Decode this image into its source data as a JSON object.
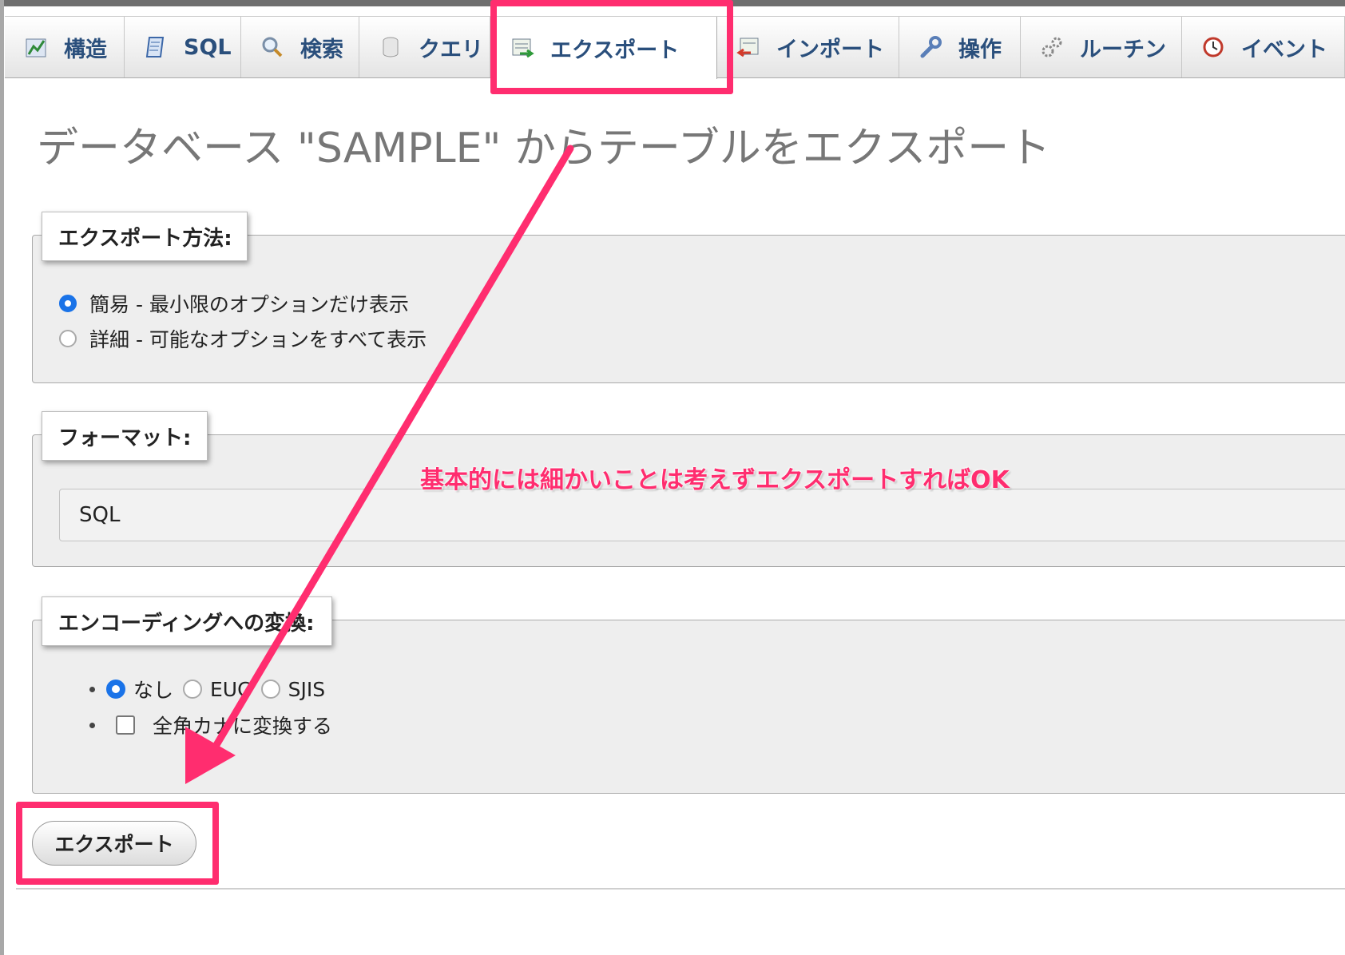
{
  "tabs": [
    {
      "label": "構造",
      "icon": "structure-icon"
    },
    {
      "label": "SQL",
      "icon": "sql-icon"
    },
    {
      "label": "検索",
      "icon": "search-icon"
    },
    {
      "label": "クエリ",
      "icon": "query-icon"
    },
    {
      "label": "エクスポート",
      "icon": "export-icon",
      "active": true
    },
    {
      "label": "インポート",
      "icon": "import-icon"
    },
    {
      "label": "操作",
      "icon": "wrench-icon"
    },
    {
      "label": "ルーチン",
      "icon": "gears-icon"
    },
    {
      "label": "イベント",
      "icon": "clock-icon"
    }
  ],
  "page": {
    "title": "データベース \"SAMPLE\" からテーブルをエクスポート"
  },
  "export_method": {
    "legend": "エクスポート方法:",
    "options": [
      {
        "label": "簡易 - 最小限のオプションだけ表示",
        "checked": true
      },
      {
        "label": "詳細 - 可能なオプションをすべて表示",
        "checked": false
      }
    ]
  },
  "format": {
    "legend": "フォーマット:",
    "selected": "SQL"
  },
  "encoding": {
    "legend": "エンコーディングへの変換:",
    "options": [
      {
        "label": "なし",
        "checked": true
      },
      {
        "label": "EUC",
        "checked": false
      },
      {
        "label": "SJIS",
        "checked": false
      }
    ],
    "checkbox_label": "全角カナに変換する",
    "checkbox_checked": false
  },
  "submit": {
    "label": "エクスポート"
  },
  "annotation": {
    "text": "基本的には細かいことは考えずエクスポートすればOK",
    "color": "#ff2d6f"
  },
  "colors": {
    "accent": "#ff2d6f",
    "radio_checked": "#1a73e8",
    "tab_text": "#2a4f7c"
  }
}
